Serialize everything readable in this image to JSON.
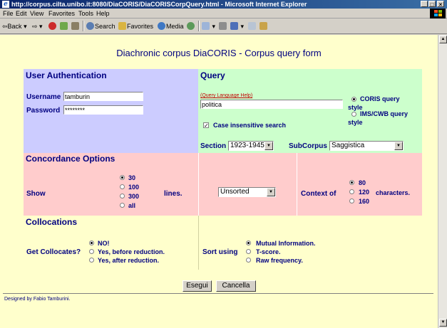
{
  "window": {
    "title": "http://corpus.cilta.unibo.it:8080/DiaCORIS/DiaCORISCorpQuery.html - Microsoft Internet Explorer"
  },
  "menu": [
    "File",
    "Edit",
    "View",
    "Favorites",
    "Tools",
    "Help"
  ],
  "toolbar": {
    "back": "Back",
    "search": "Search",
    "favorites": "Favorites",
    "media": "Media"
  },
  "page": {
    "title": "Diachronic corpus DiaCORIS - Corpus query form"
  },
  "auth": {
    "heading": "User Authentication",
    "username_label": "Username",
    "username_value": "tamburin",
    "password_label": "Password",
    "password_value": "********"
  },
  "query": {
    "heading": "Query",
    "help_link": "(Query Language Help)",
    "value": "politica",
    "coris_label_1": "CORIS query",
    "coris_label_2": "style",
    "ims_label_1": "IMS/CWB query",
    "ims_label_2": "style",
    "case_label": "Case insensitive search",
    "section_label": "Section",
    "section_value": "1923-1945",
    "subcorpus_label": "SubCorpus",
    "subcorpus_value": "Saggistica"
  },
  "concordance": {
    "heading": "Concordance Options",
    "show_label": "Show",
    "lines_label": "lines.",
    "show_options": [
      "30",
      "100",
      "300",
      "all"
    ],
    "sort_value": "Unsorted",
    "context_label": "Context of",
    "characters_label": "characters.",
    "context_options": [
      "80",
      "120",
      "160"
    ]
  },
  "collocations": {
    "heading": "Collocations",
    "get_label": "Get Collocates?",
    "get_options": [
      "NO!",
      "Yes, before reduction.",
      "Yes, after reduction."
    ],
    "sort_label": "Sort using",
    "sort_options": [
      "Mutual Information.",
      "T-score.",
      "Raw frequency."
    ]
  },
  "buttons": {
    "submit": "Esegui",
    "cancel": "Cancella"
  },
  "footer": "Designed by Fabio Tamburini.",
  "colors": {
    "auth": "#ccccff",
    "query": "#ccffcc",
    "concordance": "#ffcccc",
    "collocations": "#ffffcc",
    "label": "#000080",
    "link": "#c00000"
  }
}
